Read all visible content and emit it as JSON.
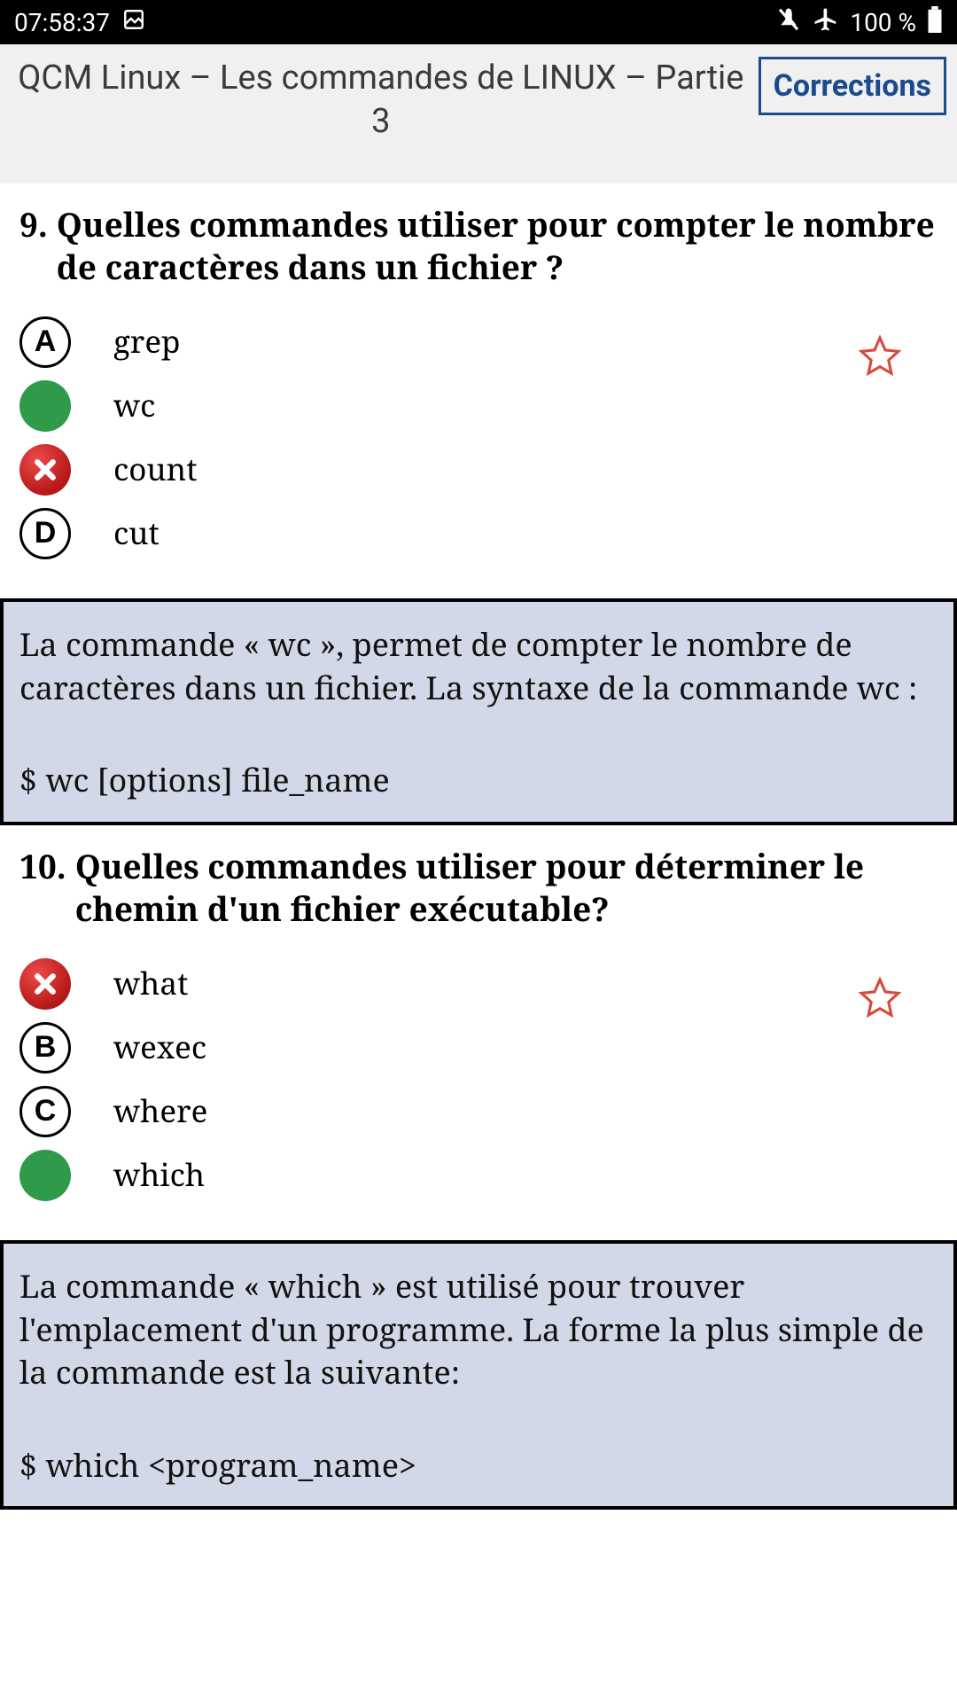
{
  "status": {
    "time": "07:58:37",
    "battery": "100 %"
  },
  "header": {
    "title": "QCM Linux – Les commandes de LINUX – Partie 3",
    "corrections": "Corrections"
  },
  "questions": [
    {
      "number": "9.",
      "text": "Quelles commandes utiliser pour compter le nombre de caractères dans un fichier ?",
      "options": [
        {
          "letter": "A",
          "text": "grep",
          "state": "letter"
        },
        {
          "letter": "",
          "text": "wc",
          "state": "correct"
        },
        {
          "letter": "",
          "text": "count",
          "state": "wrong"
        },
        {
          "letter": "D",
          "text": "cut",
          "state": "letter"
        }
      ],
      "explain_text": "La commande « wc », permet de compter le nombre de caractères dans un fichier. La syntaxe de la commande wc :",
      "explain_cmd": "$ wc [options] file_name"
    },
    {
      "number": "10.",
      "text": "Quelles commandes utiliser pour déterminer le chemin d'un fichier exécutable?",
      "options": [
        {
          "letter": "",
          "text": "what",
          "state": "wrong"
        },
        {
          "letter": "B",
          "text": "wexec",
          "state": "letter"
        },
        {
          "letter": "C",
          "text": "where",
          "state": "letter"
        },
        {
          "letter": "",
          "text": "which",
          "state": "correct"
        }
      ],
      "explain_text": "La commande « which » est utilisé pour trouver l'emplacement d'un programme. La forme la plus simple de la commande est la suivante:",
      "explain_cmd": "$ which <program_name>"
    }
  ]
}
